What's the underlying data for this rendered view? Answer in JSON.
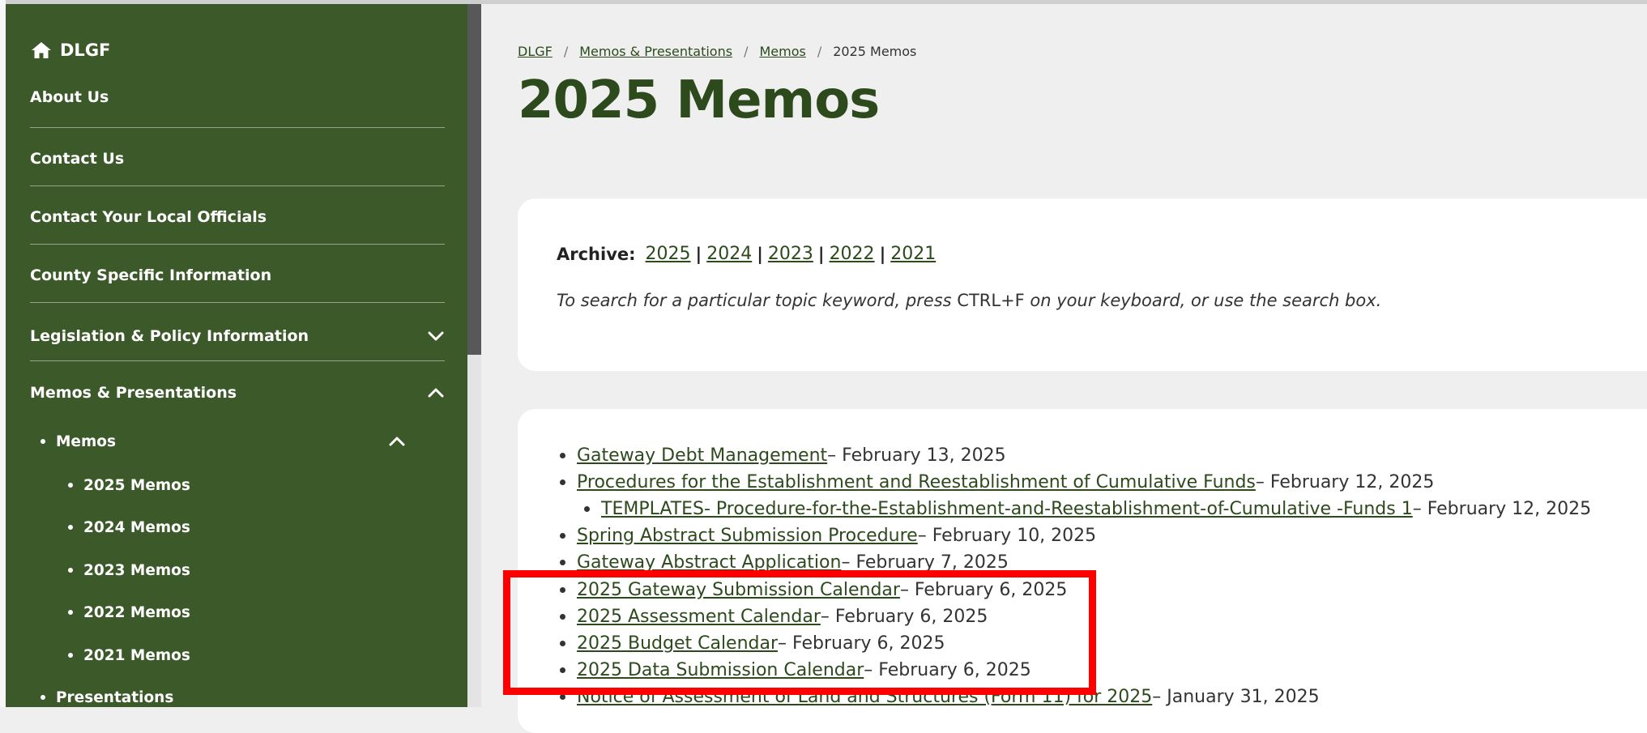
{
  "sidebar": {
    "home_label": "DLGF",
    "items": [
      {
        "label": "About Us"
      },
      {
        "label": "Contact Us"
      },
      {
        "label": "Contact Your Local Officials"
      },
      {
        "label": "County Specific Information"
      },
      {
        "label": "Legislation & Policy Information"
      },
      {
        "label": "Memos & Presentations"
      }
    ],
    "memos_label": "Memos",
    "memo_years": [
      "2025 Memos",
      "2024 Memos",
      "2023 Memos",
      "2022 Memos",
      "2021 Memos"
    ],
    "presentations_label": "Presentations"
  },
  "breadcrumb": {
    "items": [
      "DLGF",
      "Memos & Presentations",
      "Memos",
      "2025 Memos"
    ],
    "separator": "/"
  },
  "page": {
    "title": "2025 Memos"
  },
  "archive": {
    "label": "Archive:",
    "years": [
      "2025",
      "2024",
      "2023",
      "2022",
      "2021"
    ],
    "separator": "|",
    "hint_before": "To search for a particular topic keyword, press ",
    "hint_key": "CTRL+F",
    "hint_after": " on your keyboard, or use the search box."
  },
  "memos": [
    {
      "title": "Gateway Debt Management",
      "date": " – February 13, 2025"
    },
    {
      "title": "Procedures for the Establishment and Reestablishment of Cumulative Funds",
      "date": " – February 12, 2025"
    },
    {
      "title": "TEMPLATES- Procedure-for-the-Establishment-and-Reestablishment-of-Cumulative -Funds 1",
      "date": " – February 12, 2025"
    },
    {
      "title": "Spring Abstract Submission Procedure",
      "date": " – February 10, 2025"
    },
    {
      "title": "Gateway Abstract Application",
      "date": " – February 7, 2025"
    },
    {
      "title": "2025 Gateway Submission Calendar",
      "date": " – February 6, 2025"
    },
    {
      "title": "2025 Assessment Calendar",
      "date": " – February 6, 2025"
    },
    {
      "title": "2025 Budget Calendar",
      "date": " – February 6, 2025"
    },
    {
      "title": "2025 Data Submission Calendar",
      "date": " – February 6, 2025"
    },
    {
      "title": "Notice of Assessment of Land and Structures (Form 11) for 2025",
      "date": " – January 31, 2025"
    }
  ],
  "colors": {
    "sidebar_bg": "#3c592a",
    "brand_green": "#2d4a1c",
    "highlight": "#ff0000"
  }
}
